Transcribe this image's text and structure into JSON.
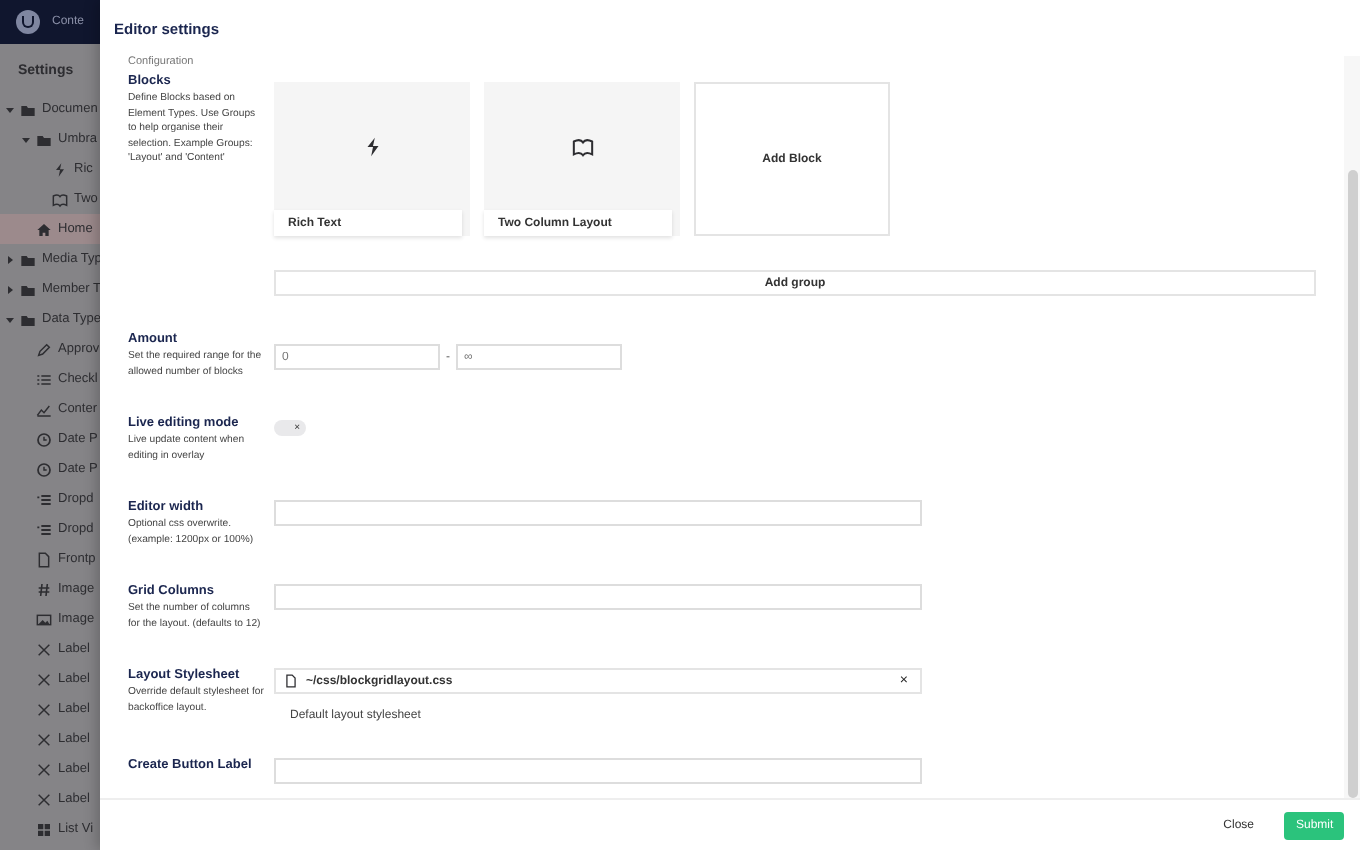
{
  "topbar": {
    "section": "Conte"
  },
  "sidebar": {
    "title": "Settings",
    "tree": [
      {
        "label": "Documen",
        "kind": "folder",
        "expanded": true,
        "selected": false,
        "children": [
          {
            "label": "Umbra",
            "kind": "folder",
            "expanded": true,
            "selected": false,
            "children": [
              {
                "label": "Ric",
                "kind": "bolt",
                "selected": false
              },
              {
                "label": "Two",
                "kind": "book",
                "selected": false
              }
            ]
          },
          {
            "label": "Home",
            "kind": "home",
            "selected": true
          }
        ]
      },
      {
        "label": "Media Typ",
        "kind": "folder",
        "expanded": false,
        "selected": false
      },
      {
        "label": "Member T",
        "kind": "folder",
        "expanded": false,
        "selected": false
      },
      {
        "label": "Data Type",
        "kind": "folder",
        "expanded": true,
        "selected": false,
        "children": [
          {
            "label": "Approv",
            "kind": "pen",
            "selected": false
          },
          {
            "label": "Checkl",
            "kind": "list",
            "selected": false
          },
          {
            "label": "Conter",
            "kind": "chart",
            "selected": false
          },
          {
            "label": "Date P",
            "kind": "clock",
            "selected": false
          },
          {
            "label": "Date P",
            "kind": "clock",
            "selected": false
          },
          {
            "label": "Dropd",
            "kind": "dropdown",
            "selected": false
          },
          {
            "label": "Dropd",
            "kind": "dropdown",
            "selected": false
          },
          {
            "label": "Frontp",
            "kind": "file",
            "selected": false
          },
          {
            "label": "Image",
            "kind": "hash",
            "selected": false
          },
          {
            "label": "Image",
            "kind": "image",
            "selected": false
          },
          {
            "label": "Label",
            "kind": "cross",
            "selected": false
          },
          {
            "label": "Label",
            "kind": "cross",
            "selected": false
          },
          {
            "label": "Label",
            "kind": "cross",
            "selected": false
          },
          {
            "label": "Label",
            "kind": "cross",
            "selected": false
          },
          {
            "label": "Label",
            "kind": "cross",
            "selected": false
          },
          {
            "label": "Label",
            "kind": "cross",
            "selected": false
          },
          {
            "label": "List Vi",
            "kind": "grid",
            "selected": false
          }
        ]
      }
    ]
  },
  "modal": {
    "title": "Editor settings",
    "section_heading": "Configuration",
    "properties": [
      {
        "kind": "blocks",
        "label": "Blocks",
        "description": "Define Blocks based on Element Types. Use Groups to help organise their selection. Example Groups: 'Layout' and 'Content'",
        "blocks": [
          {
            "name": "Rich Text",
            "kind": "bolt"
          },
          {
            "name": "Two Column Layout",
            "kind": "book"
          }
        ],
        "add_block": "Add Block",
        "add_group": "Add group"
      },
      {
        "kind": "range",
        "label": "Amount",
        "description": "Set the required range for the allowed number of blocks",
        "min_placeholder": "0",
        "separator": "-",
        "max_placeholder": "∞"
      },
      {
        "kind": "toggle",
        "label": "Live editing mode",
        "description": "Live update content when editing in overlay",
        "on": false,
        "toggle_icon": "×"
      },
      {
        "kind": "text",
        "label": "Editor width",
        "description": "Optional css overwrite. (example: 1200px or 100%)"
      },
      {
        "kind": "text",
        "label": "Grid Columns",
        "description": "Set the number of columns for the layout. (defaults to 12)"
      },
      {
        "kind": "file",
        "label": "Layout Stylesheet",
        "description": "Override default stylesheet for backoffice layout.",
        "path": "~/css/blockgridlayout.css",
        "remove": "×",
        "note": "Default layout stylesheet"
      },
      {
        "kind": "text",
        "label": "Create Button Label"
      }
    ],
    "footer": {
      "close": "Close",
      "submit": "Submit"
    }
  }
}
